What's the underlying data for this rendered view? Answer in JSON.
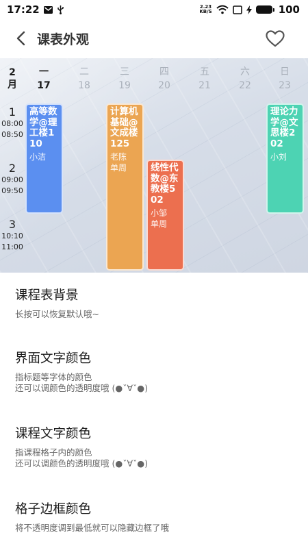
{
  "status_bar": {
    "time": "17:22",
    "net_speed_value": "2.23",
    "net_speed_unit": "KB/S",
    "battery": "100"
  },
  "header": {
    "title": "课表外观"
  },
  "preview": {
    "month": "2",
    "month_unit": "月",
    "days": [
      {
        "name": "一",
        "date": "17"
      },
      {
        "name": "二",
        "date": "18"
      },
      {
        "name": "三",
        "date": "19"
      },
      {
        "name": "四",
        "date": "20"
      },
      {
        "name": "五",
        "date": "21"
      },
      {
        "name": "六",
        "date": "22"
      },
      {
        "name": "日",
        "date": "23"
      }
    ],
    "periods": [
      {
        "num": "1",
        "start": "08:00",
        "end": "08:50"
      },
      {
        "num": "2",
        "start": "09:00",
        "end": "09:50"
      },
      {
        "num": "3",
        "start": "10:10",
        "end": "11:00"
      }
    ],
    "courses": [
      {
        "name": "高等数学@理工楼110",
        "teacher": "小洁",
        "weeks": "",
        "color": "#5b8ff0"
      },
      {
        "name": "计算机基础@文成楼125",
        "teacher": "老陈",
        "weeks": "单周",
        "color": "#eba552"
      },
      {
        "name": "线性代数@东教楼502",
        "teacher": "小邹",
        "weeks": "单周",
        "color": "#ec6f4f"
      },
      {
        "name": "理论力学@文思楼202",
        "teacher": "小刘",
        "weeks": "",
        "color": "#4dd3b3"
      }
    ]
  },
  "settings": [
    {
      "title": "课程表背景",
      "desc1": "长按可以恢复默认哦~",
      "desc2": ""
    },
    {
      "title": "界面文字颜色",
      "desc1": "指标题等字体的颜色",
      "desc2": "还可以调颜色的透明度哦 (●ˇ∀ˇ●)"
    },
    {
      "title": "课程文字颜色",
      "desc1": "指课程格子内的颜色",
      "desc2": "还可以调颜色的透明度哦 (●ˇ∀ˇ●)"
    },
    {
      "title": "格子边框颜色",
      "desc1": "将不透明度调到最低就可以隐藏边框了哦",
      "desc2": ""
    }
  ]
}
